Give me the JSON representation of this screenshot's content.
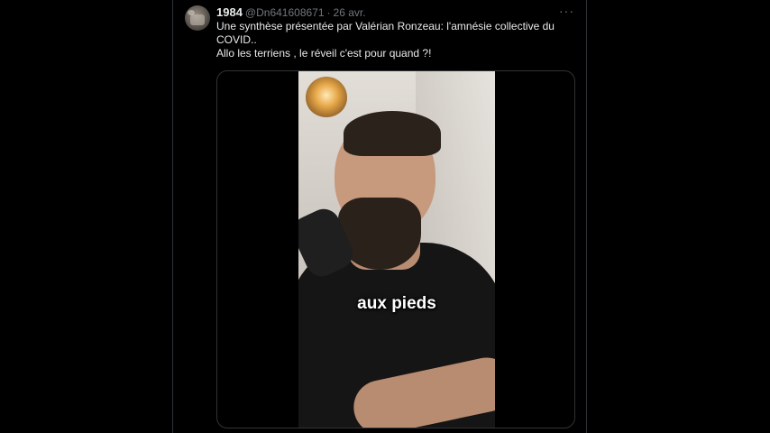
{
  "post": {
    "display_name": "1984",
    "handle": "@Dn641608671",
    "separator": "·",
    "date": "26 avr.",
    "text_line1": "Une synthèse présentée par Valérian Ronzeau: l'amnésie collective du COVID..",
    "text_line2": "Allo les terriens , le réveil c'est pour quand ?!",
    "more_icon": "more-horizontal-icon",
    "more_glyph": "···"
  },
  "video": {
    "caption": "aux pieds"
  },
  "colors": {
    "background": "#000000",
    "text": "#e7e9ea",
    "secondary": "#71767b",
    "border": "#2f3336"
  }
}
